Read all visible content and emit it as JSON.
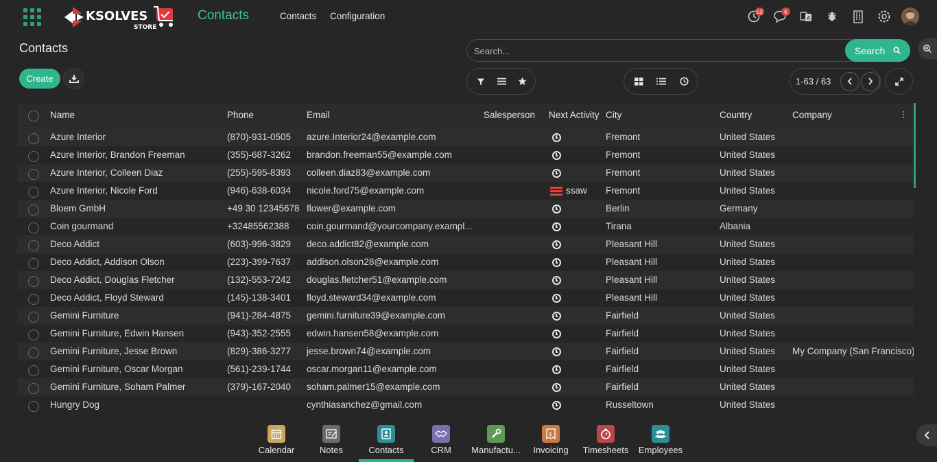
{
  "header": {
    "brand_line1": "KSOLVES",
    "brand_line2": "STORE",
    "app_title": "Contacts",
    "menu": [
      "Contacts",
      "Configuration"
    ],
    "activity_badge": "52",
    "messages_badge": "6"
  },
  "control_panel": {
    "page_title": "Contacts",
    "create_label": "Create",
    "search_placeholder": "Search...",
    "search_button_label": "Search",
    "pager_text": "1-63 / 63"
  },
  "table": {
    "columns": [
      "Name",
      "Phone",
      "Email",
      "Salesperson",
      "Next Activity",
      "City",
      "Country",
      "Company"
    ],
    "rows": [
      {
        "name": "Azure Interior",
        "phone": "(870)-931-0505",
        "email": "azure.Interior24@example.com",
        "activity": "clock",
        "activity_label": "",
        "city": "Fremont",
        "country": "United States",
        "company": ""
      },
      {
        "name": "Azure Interior, Brandon Freeman",
        "phone": "(355)-687-3262",
        "email": "brandon.freeman55@example.com",
        "activity": "clock",
        "activity_label": "",
        "city": "Fremont",
        "country": "United States",
        "company": ""
      },
      {
        "name": "Azure Interior, Colleen Diaz",
        "phone": "(255)-595-8393",
        "email": "colleen.diaz83@example.com",
        "activity": "clock",
        "activity_label": "",
        "city": "Fremont",
        "country": "United States",
        "company": ""
      },
      {
        "name": "Azure Interior, Nicole Ford",
        "phone": "(946)-638-6034",
        "email": "nicole.ford75@example.com",
        "activity": "bars",
        "activity_label": "ssaw",
        "city": "Fremont",
        "country": "United States",
        "company": ""
      },
      {
        "name": "Bloem GmbH",
        "phone": "+49 30 12345678",
        "email": "flower@example.com",
        "activity": "clock",
        "activity_label": "",
        "city": "Berlin",
        "country": "Germany",
        "company": ""
      },
      {
        "name": "Coin gourmand",
        "phone": "+32485562388",
        "email": "coin.gourmand@yourcompany.exampl...",
        "activity": "clock",
        "activity_label": "",
        "city": "Tirana",
        "country": "Albania",
        "company": ""
      },
      {
        "name": "Deco Addict",
        "phone": "(603)-996-3829",
        "email": "deco.addict82@example.com",
        "activity": "clock",
        "activity_label": "",
        "city": "Pleasant Hill",
        "country": "United States",
        "company": ""
      },
      {
        "name": "Deco Addict, Addison Olson",
        "phone": "(223)-399-7637",
        "email": "addison.olson28@example.com",
        "activity": "clock",
        "activity_label": "",
        "city": "Pleasant Hill",
        "country": "United States",
        "company": ""
      },
      {
        "name": "Deco Addict, Douglas Fletcher",
        "phone": "(132)-553-7242",
        "email": "douglas.fletcher51@example.com",
        "activity": "clock",
        "activity_label": "",
        "city": "Pleasant Hill",
        "country": "United States",
        "company": ""
      },
      {
        "name": "Deco Addict, Floyd Steward",
        "phone": "(145)-138-3401",
        "email": "floyd.steward34@example.com",
        "activity": "clock",
        "activity_label": "",
        "city": "Pleasant Hill",
        "country": "United States",
        "company": ""
      },
      {
        "name": "Gemini Furniture",
        "phone": "(941)-284-4875",
        "email": "gemini.furniture39@example.com",
        "activity": "clock",
        "activity_label": "",
        "city": "Fairfield",
        "country": "United States",
        "company": ""
      },
      {
        "name": "Gemini Furniture, Edwin Hansen",
        "phone": "(943)-352-2555",
        "email": "edwin.hansen58@example.com",
        "activity": "clock",
        "activity_label": "",
        "city": "Fairfield",
        "country": "United States",
        "company": ""
      },
      {
        "name": "Gemini Furniture, Jesse Brown",
        "phone": "(829)-386-3277",
        "email": "jesse.brown74@example.com",
        "activity": "clock",
        "activity_label": "",
        "city": "Fairfield",
        "country": "United States",
        "company": "My Company (San Francisco)"
      },
      {
        "name": "Gemini Furniture, Oscar Morgan",
        "phone": "(561)-239-1744",
        "email": "oscar.morgan11@example.com",
        "activity": "clock",
        "activity_label": "",
        "city": "Fairfield",
        "country": "United States",
        "company": ""
      },
      {
        "name": "Gemini Furniture, Soham Palmer",
        "phone": "(379)-167-2040",
        "email": "soham.palmer15@example.com",
        "activity": "clock",
        "activity_label": "",
        "city": "Fairfield",
        "country": "United States",
        "company": ""
      },
      {
        "name": "Hungry Dog",
        "phone": "",
        "email": "cynthiasanchez@gmail.com",
        "activity": "clock",
        "activity_label": "",
        "city": "Russeltown",
        "country": "United States",
        "company": ""
      }
    ]
  },
  "dock": [
    {
      "label": "Calendar",
      "icon": "calendar-icon",
      "color": "#c9a85a"
    },
    {
      "label": "Notes",
      "icon": "notes-icon",
      "color": "#6b6b6b"
    },
    {
      "label": "Contacts",
      "icon": "contacts-icon",
      "color": "#2a8f96",
      "active": true
    },
    {
      "label": "CRM",
      "icon": "crm-icon",
      "color": "#7b6fb0"
    },
    {
      "label": "Manufactu...",
      "icon": "manufacturing-icon",
      "color": "#5e9a55"
    },
    {
      "label": "Invoicing",
      "icon": "invoicing-icon",
      "color": "#c77a45"
    },
    {
      "label": "Timesheets",
      "icon": "timesheets-icon",
      "color": "#b9474a"
    },
    {
      "label": "Employees",
      "icon": "employees-icon",
      "color": "#2a8f96"
    }
  ],
  "colors": {
    "accent": "#30b68e",
    "title": "#3cc3a0",
    "badge": "#d2443f",
    "background": "#262626"
  }
}
